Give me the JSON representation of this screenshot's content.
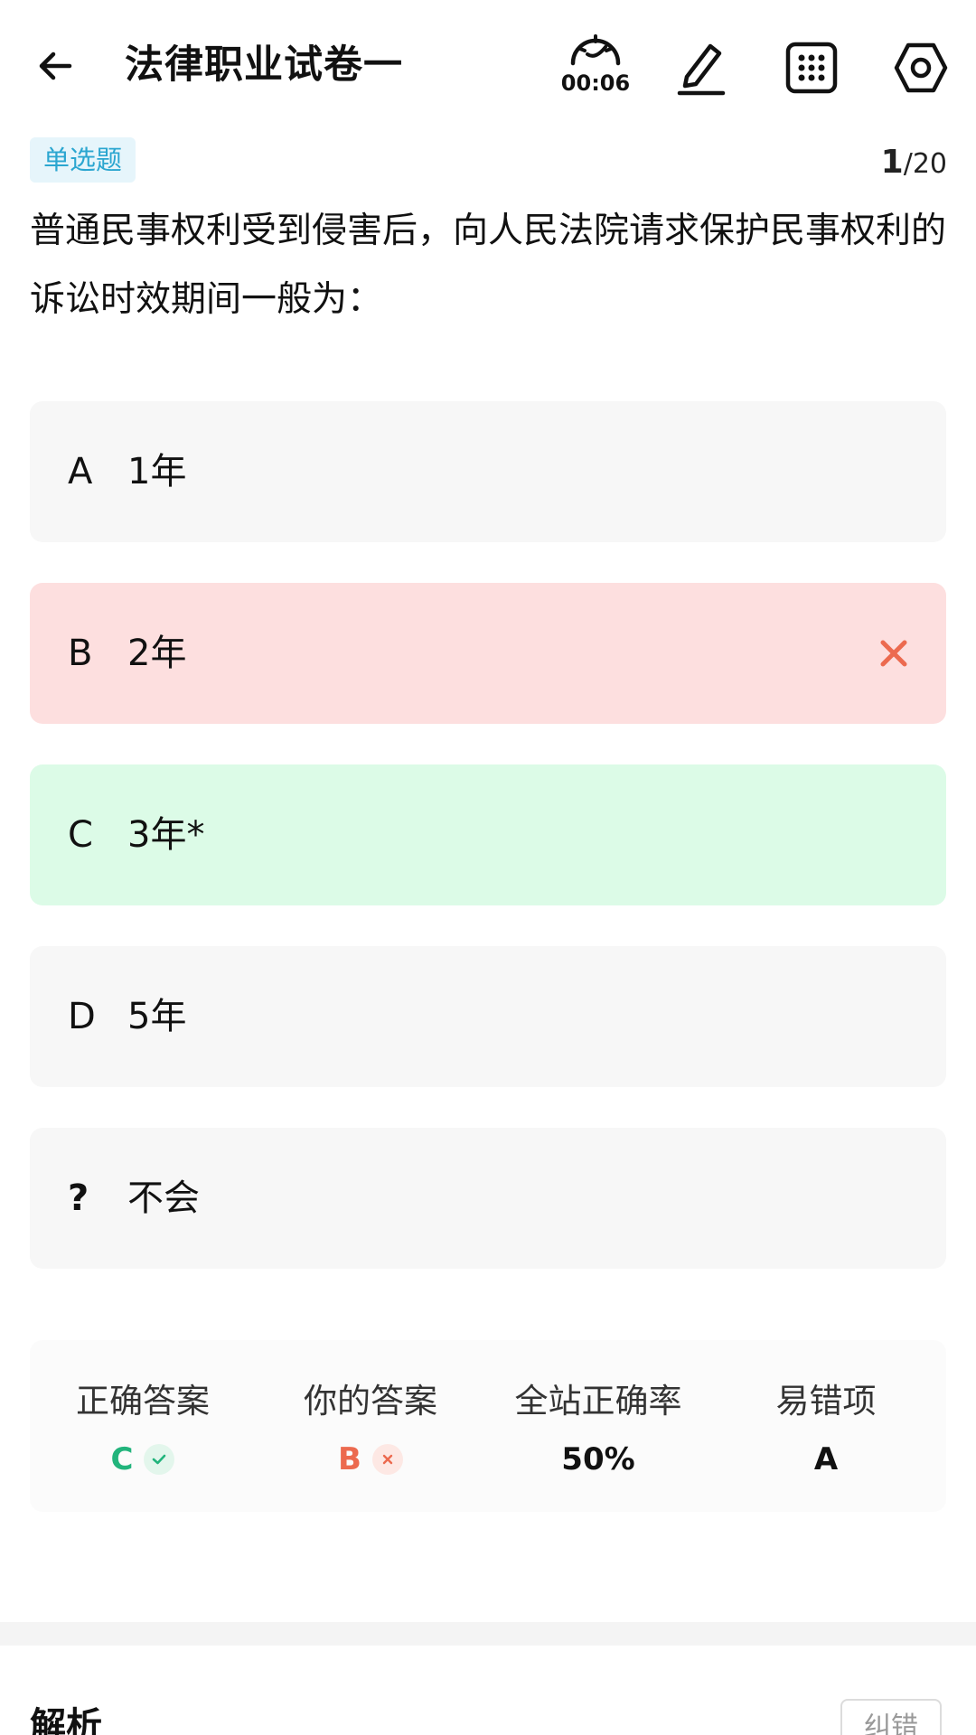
{
  "header": {
    "title": "法律职业试卷一",
    "timer": "00:06"
  },
  "question": {
    "type_label": "单选题",
    "current": "1",
    "total": "/20",
    "text": "普通民事权利受到侵害后，向人民法院请求保护民事权利的诉讼时效期间一般为："
  },
  "options": [
    {
      "letter": "A",
      "text": "1年",
      "state": "normal"
    },
    {
      "letter": "B",
      "text": "2年",
      "state": "wrong"
    },
    {
      "letter": "C",
      "text": "3年*",
      "state": "correct"
    },
    {
      "letter": "D",
      "text": "5年",
      "state": "normal"
    },
    {
      "letter": "?",
      "text": "不会",
      "state": "normal"
    }
  ],
  "stats": {
    "correct_answer_label": "正确答案",
    "correct_answer_value": "C",
    "your_answer_label": "你的答案",
    "your_answer_value": "B",
    "site_accuracy_label": "全站正确率",
    "site_accuracy_value": "50%",
    "common_mistake_label": "易错项",
    "common_mistake_value": "A"
  },
  "analysis": {
    "title": "解析",
    "report_button": "纠错"
  },
  "colors": {
    "wrong_bg": "#fddfdf",
    "correct_bg": "#dcfbe7",
    "correct_text": "#22b47c",
    "wrong_text": "#ec6a4f",
    "badge_text": "#2ba6d0"
  },
  "icons": {
    "back": "arrow-left-icon",
    "timer": "speedometer-icon",
    "edit": "pencil-icon",
    "grid": "grid-dots-icon",
    "settings": "hexagon-settings-icon"
  }
}
